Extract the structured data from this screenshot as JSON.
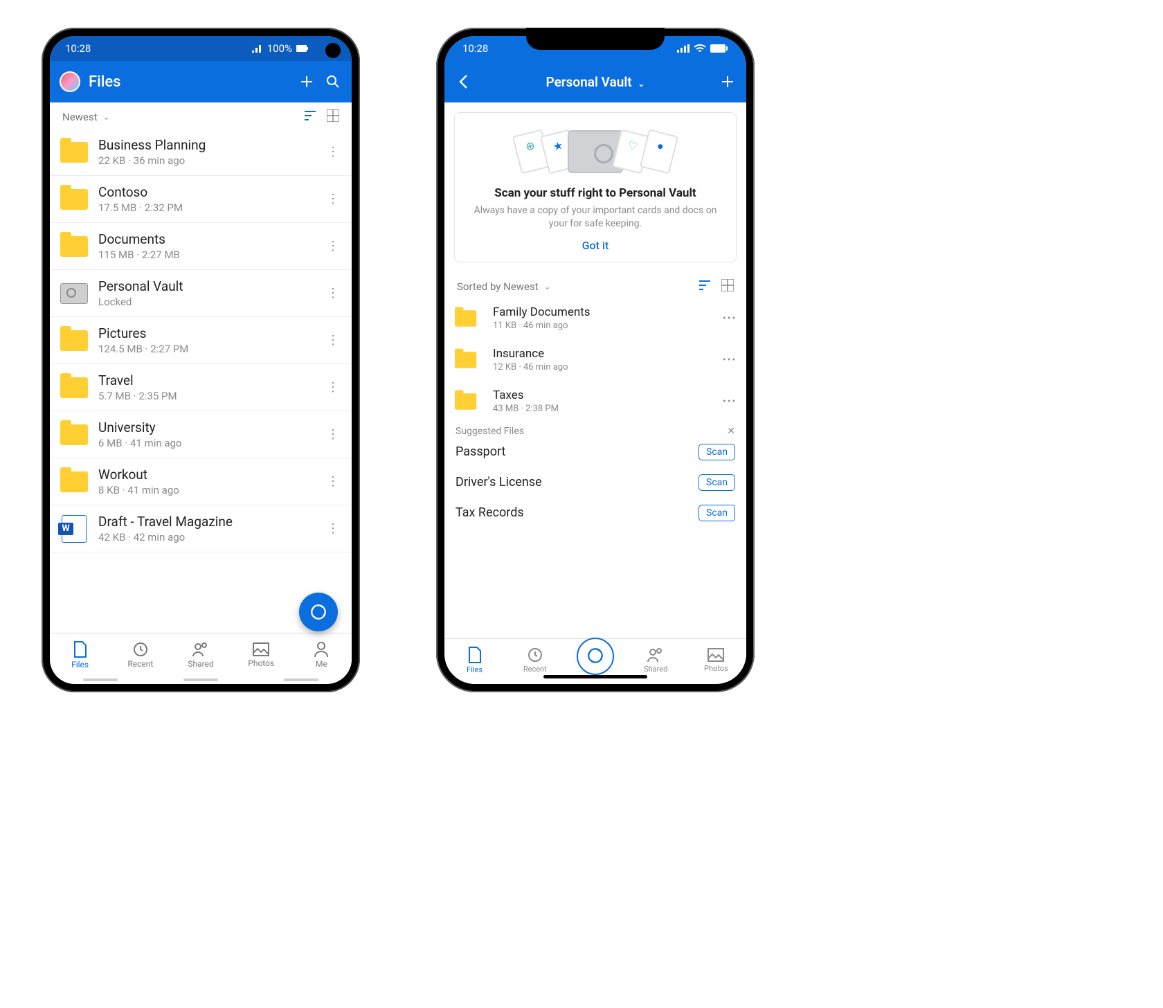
{
  "android": {
    "status": {
      "time": "10:28",
      "battery": "100%"
    },
    "header": {
      "title": "Files"
    },
    "sort": {
      "label": "Newest"
    },
    "files": [
      {
        "name": "Business Planning",
        "meta": "22 KB · 36 min ago",
        "type": "folder"
      },
      {
        "name": "Contoso",
        "meta": "17.5 MB · 2:32 PM",
        "type": "folder"
      },
      {
        "name": "Documents",
        "meta": "115 MB · 2:27 MB",
        "type": "folder"
      },
      {
        "name": "Personal Vault",
        "meta": "Locked",
        "type": "vault"
      },
      {
        "name": "Pictures",
        "meta": "124.5 MB · 2:27 PM",
        "type": "folder"
      },
      {
        "name": "Travel",
        "meta": "5.7 MB · 2:35 PM",
        "type": "folder"
      },
      {
        "name": "University",
        "meta": "6 MB · 41 min ago",
        "type": "folder"
      },
      {
        "name": "Workout",
        "meta": "8 KB · 41 min ago",
        "type": "folder"
      },
      {
        "name": "Draft - Travel Magazine",
        "meta": "42 KB · 42 min ago",
        "type": "word"
      }
    ],
    "tabs": [
      "Files",
      "Recent",
      "Shared",
      "Photos",
      "Me"
    ]
  },
  "ios": {
    "status": {
      "time": "10:28"
    },
    "header": {
      "title": "Personal Vault"
    },
    "card": {
      "title": "Scan your stuff right to Personal Vault",
      "subtitle": "Always have a copy of your important cards and docs on your for safe keeping.",
      "cta": "Got it"
    },
    "sort": {
      "label": "Sorted by Newest"
    },
    "files": [
      {
        "name": "Family Documents",
        "meta": "11 KB · 46 min ago"
      },
      {
        "name": "Insurance",
        "meta": "12 KB · 46 min ago"
      },
      {
        "name": "Taxes",
        "meta": "43 MB · 2:38 PM"
      }
    ],
    "suggested": {
      "label": "Suggested Files",
      "scan_label": "Scan",
      "items": [
        "Passport",
        "Driver's License",
        "Tax Records"
      ]
    },
    "tabs": [
      "Files",
      "Recent",
      "",
      "Shared",
      "Photos"
    ]
  }
}
